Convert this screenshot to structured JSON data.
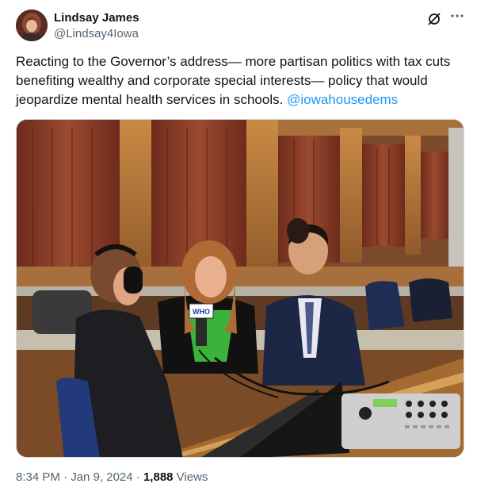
{
  "author": {
    "display_name": "Lindsay James",
    "handle": "@Lindsay4Iowa"
  },
  "tweet": {
    "text": "Reacting to the Governor’s address— more partisan politics with tax cuts benefiting wealthy and corporate special interests— policy that would jeopardize mental health services in schools. ",
    "mention": "@iowahousedems"
  },
  "meta": {
    "time": "8:34 PM",
    "separator": " · ",
    "date": "Jan 9, 2024",
    "views_count": "1,888",
    "views_label": " Views"
  },
  "photo": {
    "mic_flag_text": "WHO"
  },
  "icons": {
    "grok": "grok-slash-icon",
    "more": "more-dots-icon"
  },
  "colors": {
    "accent": "#1d9bf0",
    "secondary_text": "#536471",
    "primary_text": "#0f1419"
  }
}
